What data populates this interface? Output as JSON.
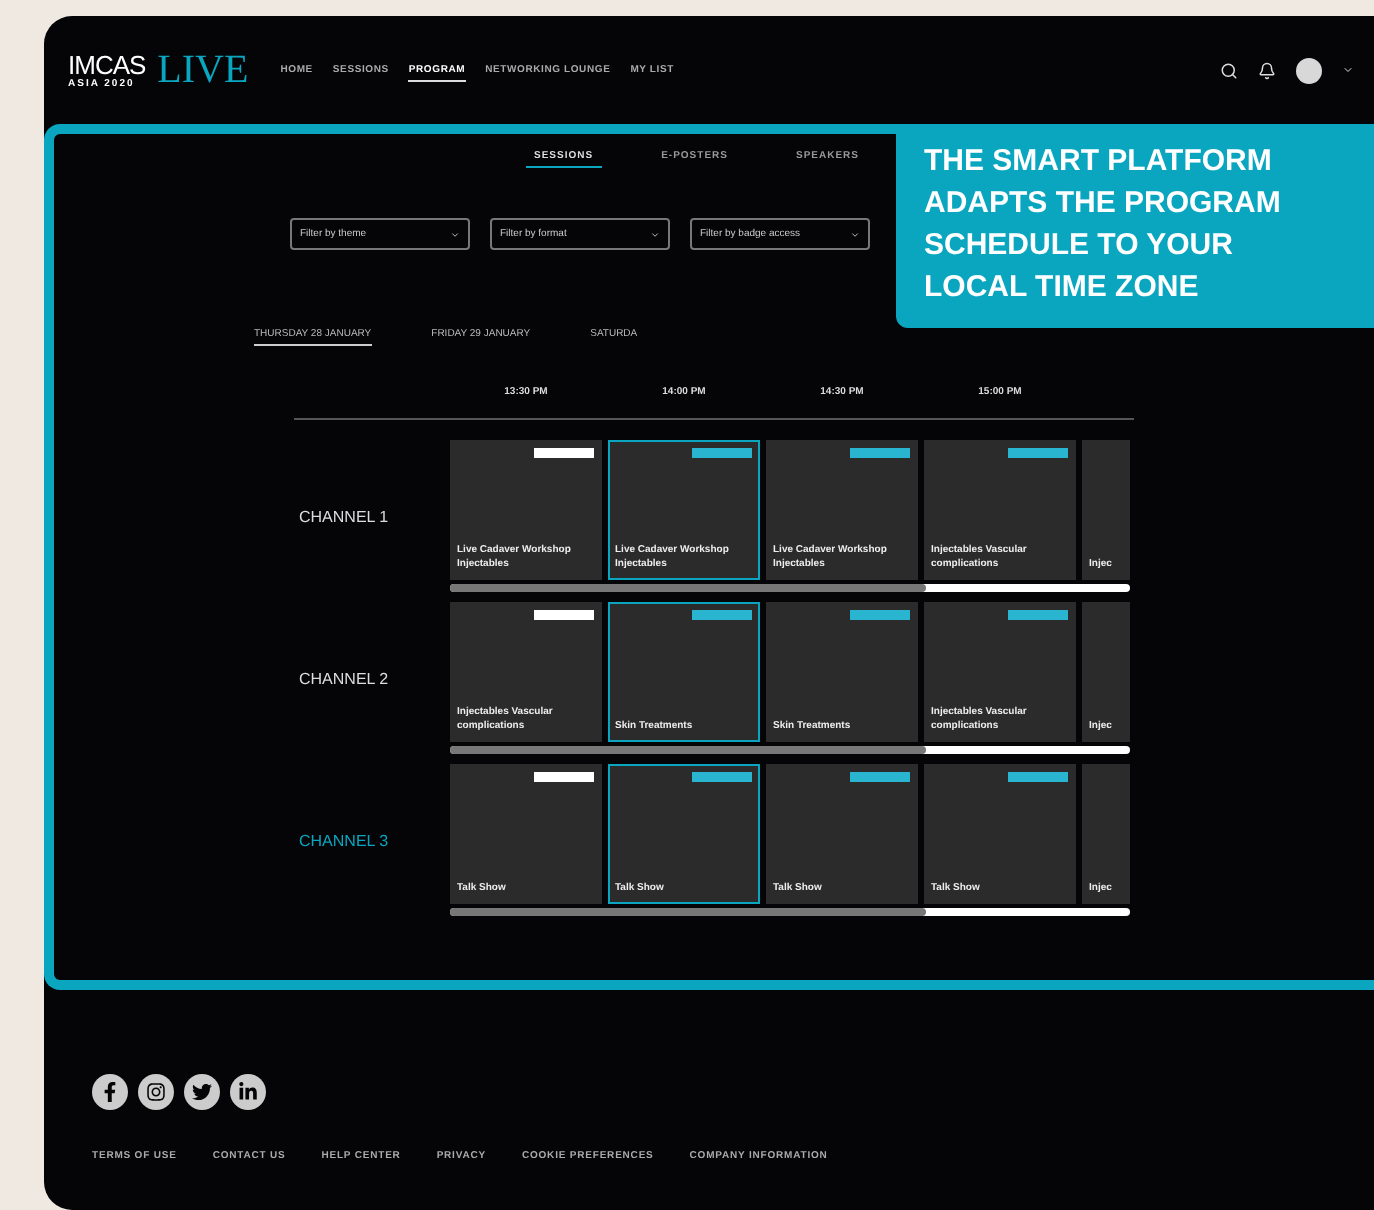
{
  "header": {
    "logo": {
      "name": "IMCAS",
      "subtitle": "ASIA 2020",
      "mark": "LIVE"
    },
    "nav": [
      {
        "label": "HOME",
        "selected": false
      },
      {
        "label": "SESSIONS",
        "selected": false
      },
      {
        "label": "PROGRAM",
        "selected": true
      },
      {
        "label": "NETWORKING LOUNGE",
        "selected": false
      },
      {
        "label": "MY LIST",
        "selected": false
      }
    ]
  },
  "tabs": [
    {
      "label": "SESSIONS",
      "selected": true
    },
    {
      "label": "E-POSTERS",
      "selected": false
    },
    {
      "label": "SPEAKERS",
      "selected": false
    }
  ],
  "filters": [
    {
      "placeholder": "Filter by theme"
    },
    {
      "placeholder": "Filter by format"
    },
    {
      "placeholder": "Filter by badge access"
    }
  ],
  "days": [
    {
      "label": "THURSDAY 28 JANUARY",
      "selected": true
    },
    {
      "label": "FRIDAY 29 JANUARY",
      "selected": false
    },
    {
      "label": "SATURDA",
      "selected": false
    }
  ],
  "times": [
    "13:30 PM",
    "14:00 PM",
    "14:30 PM",
    "15:00 PM"
  ],
  "channels": [
    {
      "name": "CHANNEL 1",
      "selected": false,
      "cards": [
        {
          "title": "Live Cadaver Workshop Injectables",
          "selected": false,
          "color": "#ffffff"
        },
        {
          "title": "Live Cadaver Workshop Injectables",
          "selected": true,
          "color": "#29b5cf"
        },
        {
          "title": "Live Cadaver Workshop Injectables",
          "selected": false,
          "color": "#29b5cf"
        },
        {
          "title": "Injectables Vascular complications",
          "selected": false,
          "color": "#29b5cf"
        },
        {
          "title": "Injec",
          "selected": false
        }
      ]
    },
    {
      "name": "CHANNEL 2",
      "selected": false,
      "cards": [
        {
          "title": "Injectables Vascular complications",
          "selected": false,
          "color": "#ffffff"
        },
        {
          "title": "Skin Treatments",
          "selected": true,
          "color": "#29b5cf"
        },
        {
          "title": "Skin Treatments",
          "selected": false,
          "color": "#29b5cf"
        },
        {
          "title": "Injectables Vascular complications",
          "selected": false,
          "color": "#29b5cf"
        },
        {
          "title": "Injec",
          "selected": false
        }
      ]
    },
    {
      "name": "CHANNEL 3",
      "selected": true,
      "cards": [
        {
          "title": "Talk Show",
          "selected": false,
          "color": "#ffffff"
        },
        {
          "title": "Talk Show",
          "selected": true,
          "color": "#29b5cf"
        },
        {
          "title": "Talk Show",
          "selected": false,
          "color": "#29b5cf"
        },
        {
          "title": "Talk Show",
          "selected": false,
          "color": "#29b5cf"
        },
        {
          "title": "Injec",
          "selected": false
        }
      ]
    }
  ],
  "callout": "THE SMART PLATFORM ADAPTS THE PROGRAM SCHEDULE TO YOUR LOCAL TIME ZONE",
  "footer": {
    "social": [
      {
        "kind": "facebook"
      },
      {
        "kind": "instagram"
      },
      {
        "kind": "twitter"
      },
      {
        "kind": "linkedin"
      }
    ],
    "links": [
      "TERMS OF USE",
      "CONTACT US",
      "HELP CENTER",
      "PRIVACY",
      "COOKIE PREFERENCES",
      "COMPANY INFORMATION"
    ]
  }
}
